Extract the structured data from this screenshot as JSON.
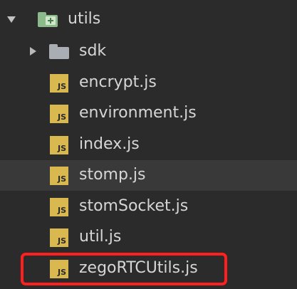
{
  "tree": {
    "root_folder": {
      "label": "utils",
      "icon": "folder-green-plus-icon",
      "expanded": true
    },
    "subfolder": {
      "label": "sdk",
      "icon": "folder-icon",
      "expanded": false
    },
    "files": [
      {
        "label": "encrypt.js",
        "icon": "js-file-icon",
        "icon_text": "JS"
      },
      {
        "label": "environment.js",
        "icon": "js-file-icon",
        "icon_text": "JS"
      },
      {
        "label": "index.js",
        "icon": "js-file-icon",
        "icon_text": "JS"
      },
      {
        "label": "stomp.js",
        "icon": "js-file-icon",
        "icon_text": "JS",
        "selected": true
      },
      {
        "label": "stomSocket.js",
        "icon": "js-file-icon",
        "icon_text": "JS"
      },
      {
        "label": "util.js",
        "icon": "js-file-icon",
        "icon_text": "JS"
      },
      {
        "label": "zegoRTCUtils.js",
        "icon": "js-file-icon",
        "icon_text": "JS",
        "highlighted": true
      }
    ]
  },
  "colors": {
    "background": "#2b2b2b",
    "selected_row": "#393939",
    "highlight_border": "#ff1f1f",
    "js_icon": "#d9b84f"
  }
}
